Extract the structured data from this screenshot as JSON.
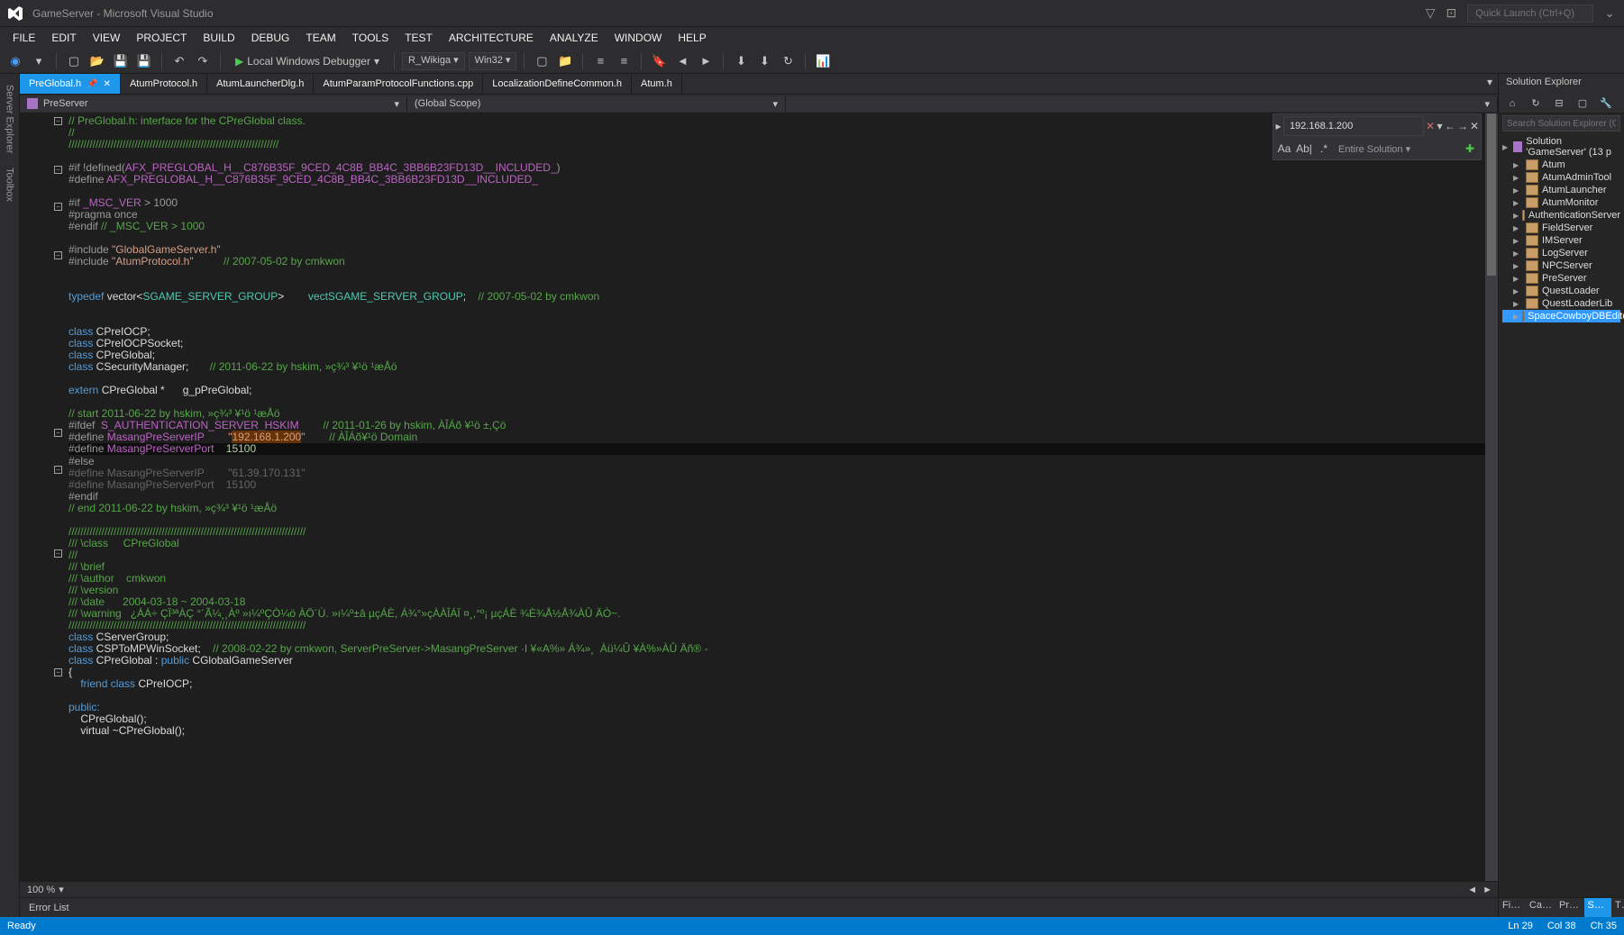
{
  "title": "GameServer - Microsoft Visual Studio",
  "quick_launch_placeholder": "Quick Launch (Ctrl+Q)",
  "menus": [
    "FILE",
    "EDIT",
    "VIEW",
    "PROJECT",
    "BUILD",
    "DEBUG",
    "TEAM",
    "TOOLS",
    "TEST",
    "ARCHITECTURE",
    "ANALYZE",
    "WINDOW",
    "HELP"
  ],
  "toolbar": {
    "debug_label": "Local Windows Debugger",
    "config": "R_Wikiga",
    "platform": "Win32"
  },
  "file_tabs": [
    {
      "label": "PreGlobal.h",
      "active": true,
      "pinned": true
    },
    {
      "label": "AtumProtocol.h"
    },
    {
      "label": "AtumLauncherDlg.h"
    },
    {
      "label": "AtumParamProtocolFunctions.cpp"
    },
    {
      "label": "LocalizationDefineCommon.h"
    },
    {
      "label": "Atum.h"
    }
  ],
  "nav": {
    "project": "PreServer",
    "scope": "(Global Scope)"
  },
  "search": {
    "value": "192.168.1.200",
    "scope": "Entire Solution",
    "opt_case": "Aa",
    "opt_word": "Ab|"
  },
  "code": [
    {
      "t": "c",
      "fold": "-",
      "s": "// PreGlobal.h: interface for the CPreGlobal class."
    },
    {
      "t": "c",
      "s": "//"
    },
    {
      "t": "c",
      "s": "//////////////////////////////////////////////////////////////////////"
    },
    {
      "t": "blank"
    },
    {
      "t": "pp",
      "fold": "-",
      "s": "#if !defined(",
      "mac": "AFX_PREGLOBAL_H__C876B35F_9CED_4C8B_BB4C_3BB6B23FD13D__INCLUDED_",
      "tail": ")"
    },
    {
      "t": "pp",
      "s": "#define ",
      "mac": "AFX_PREGLOBAL_H__C876B35F_9CED_4C8B_BB4C_3BB6B23FD13D__INCLUDED_"
    },
    {
      "t": "blank"
    },
    {
      "t": "pp",
      "fold": "-",
      "s": "#if ",
      "mac": "_MSC_VER",
      "tail": " > 1000"
    },
    {
      "t": "pp",
      "s": "#pragma once"
    },
    {
      "t": "pp",
      "s": "#endif ",
      "c": "// _MSC_VER > 1000"
    },
    {
      "t": "blank"
    },
    {
      "t": "inc",
      "fold": "-",
      "s": "#include ",
      "str": "\"GlobalGameServer.h\""
    },
    {
      "t": "inc",
      "s": "#include ",
      "str": "\"AtumProtocol.h\"",
      "pad": "          ",
      "c": "// 2007-05-02 by cmkwon"
    },
    {
      "t": "blank"
    },
    {
      "t": "blank"
    },
    {
      "t": "td",
      "kw": "typedef",
      "body": " vector<",
      "ty": "SGAME_SERVER_GROUP",
      "body2": ">        ",
      "ty2": "vectSGAME_SERVER_GROUP",
      "body3": ";    ",
      "c": "// 2007-05-02 by cmkwon"
    },
    {
      "t": "blank"
    },
    {
      "t": "blank"
    },
    {
      "t": "cls",
      "kw": "class",
      "name": " CPreIOCP;"
    },
    {
      "t": "cls",
      "kw": "class",
      "name": " CPreIOCPSocket;"
    },
    {
      "t": "cls",
      "kw": "class",
      "name": " CPreGlobal;"
    },
    {
      "t": "cls",
      "kw": "class",
      "name": " CSecurityManager;       ",
      "c": "// 2011-06-22 by hskim, »ç¾³ ¥¹ö ¹æÅö"
    },
    {
      "t": "blank"
    },
    {
      "t": "ext",
      "kw": "extern",
      "body": " CPreGlobal *      g_pPreGlobal;"
    },
    {
      "t": "blank"
    },
    {
      "t": "c",
      "s": "// start 2011-06-22 by hskim, »ç¾³ ¥¹ö ¹æÅö"
    },
    {
      "t": "pp",
      "fold": "-",
      "s": "#ifdef  ",
      "mac": "S_AUTHENTICATION_SERVER_HSKIM",
      "pad": "        ",
      "c": "// 2011-01-26 by hskim, ÀÎÁõ ¥¹ö ±,Çö"
    },
    {
      "t": "def",
      "s": "#define ",
      "mac": "MasangPreServerIP",
      "pad": "        ",
      "strpre": "\"",
      "hl": "192.168.1.200",
      "strpost": "\"",
      "pad2": "        ",
      "c": "// ÀÎÁõ¥¹ö Domain"
    },
    {
      "t": "def-hl",
      "s": "#define ",
      "mac": "MasangPreServerPort",
      "pad": "    ",
      "num": "15100"
    },
    {
      "t": "pp",
      "fold": "-",
      "s": "#else"
    },
    {
      "t": "inactive",
      "s": "#define MasangPreServerIP        \"61.39.170.131\""
    },
    {
      "t": "inactive",
      "s": "#define MasangPreServerPort    15100"
    },
    {
      "t": "pp",
      "s": "#endif"
    },
    {
      "t": "c",
      "s": "// end 2011-06-22 by hskim, »ç¾³ ¥¹ö ¹æÅö"
    },
    {
      "t": "blank"
    },
    {
      "t": "c",
      "s": "///////////////////////////////////////////////////////////////////////////////"
    },
    {
      "t": "c",
      "fold": "-",
      "s": "/// \\class     CPreGlobal"
    },
    {
      "t": "c",
      "s": "///"
    },
    {
      "t": "c",
      "s": "/// \\brief"
    },
    {
      "t": "c",
      "s": "/// \\author    cmkwon"
    },
    {
      "t": "c",
      "s": "/// \\version"
    },
    {
      "t": "c",
      "s": "/// \\date      2004-03-18 ~ 2004-03-18"
    },
    {
      "t": "c",
      "s": "/// \\warning   ¿ÁÁ÷ ÇÏ³ªÀÇ °´Ã¼¸¸Àº »ı¼ºÇÒ¼ö ÀÖ´Ù. »ı¼º±â µçÁÈ, Á¾°»çÀÀÎÁÏ ¤¸,°º¡ µçÁÈ ¾È¾Å½Å¾ÀÛ ÄÒ~."
    },
    {
      "t": "c",
      "s": "///////////////////////////////////////////////////////////////////////////////"
    },
    {
      "t": "cls",
      "kw": "class",
      "name": " CServerGroup;"
    },
    {
      "t": "cls",
      "kw": "class",
      "name": " CSPToMPWinSocket;    ",
      "c": "// 2008-02-22 by cmkwon, ServerPreServer->MasangPreServer ·I ¥«A%» Á¾»¸  Àü¼Û ¥À%»ÀÛ Äñ® -"
    },
    {
      "t": "clsdef",
      "fold": "-",
      "kw": "class",
      "name": " CPreGlobal : ",
      "kw2": "public",
      "name2": " CGlobalGameServer"
    },
    {
      "t": "plain",
      "s": "{"
    },
    {
      "t": "friend",
      "pad": "    ",
      "kw": "friend class",
      "name": " CPreIOCP;"
    },
    {
      "t": "blank"
    },
    {
      "t": "kw",
      "pad": "",
      "kw": "public:"
    },
    {
      "t": "plain",
      "s": "    CPreGlobal();"
    },
    {
      "t": "plain",
      "s": "    virtual ~CPreGlobal();"
    }
  ],
  "zoom": "100 %",
  "bottom_tabs": [
    "Error List"
  ],
  "solution_explorer": {
    "title": "Solution Explorer",
    "search_placeholder": "Search Solution Explorer (Ctrl+;)",
    "root": "Solution 'GameServer' (13 p",
    "projects": [
      "Atum",
      "AtumAdminTool",
      "AtumLauncher",
      "AtumMonitor",
      "AuthenticationServer",
      "FieldServer",
      "IMServer",
      "LogServer",
      "NPCServer",
      "PreServer",
      "QuestLoader",
      "QuestLoaderLib",
      "SpaceCowboyDBEditorT"
    ]
  },
  "right_tabs": [
    "Fin...",
    "Call...",
    "Pro...",
    "Sol...",
    "T"
  ],
  "right_tabs_active": 3,
  "status": {
    "state": "Ready",
    "ln": "Ln 29",
    "col": "Col 38",
    "ch": "Ch 35"
  }
}
